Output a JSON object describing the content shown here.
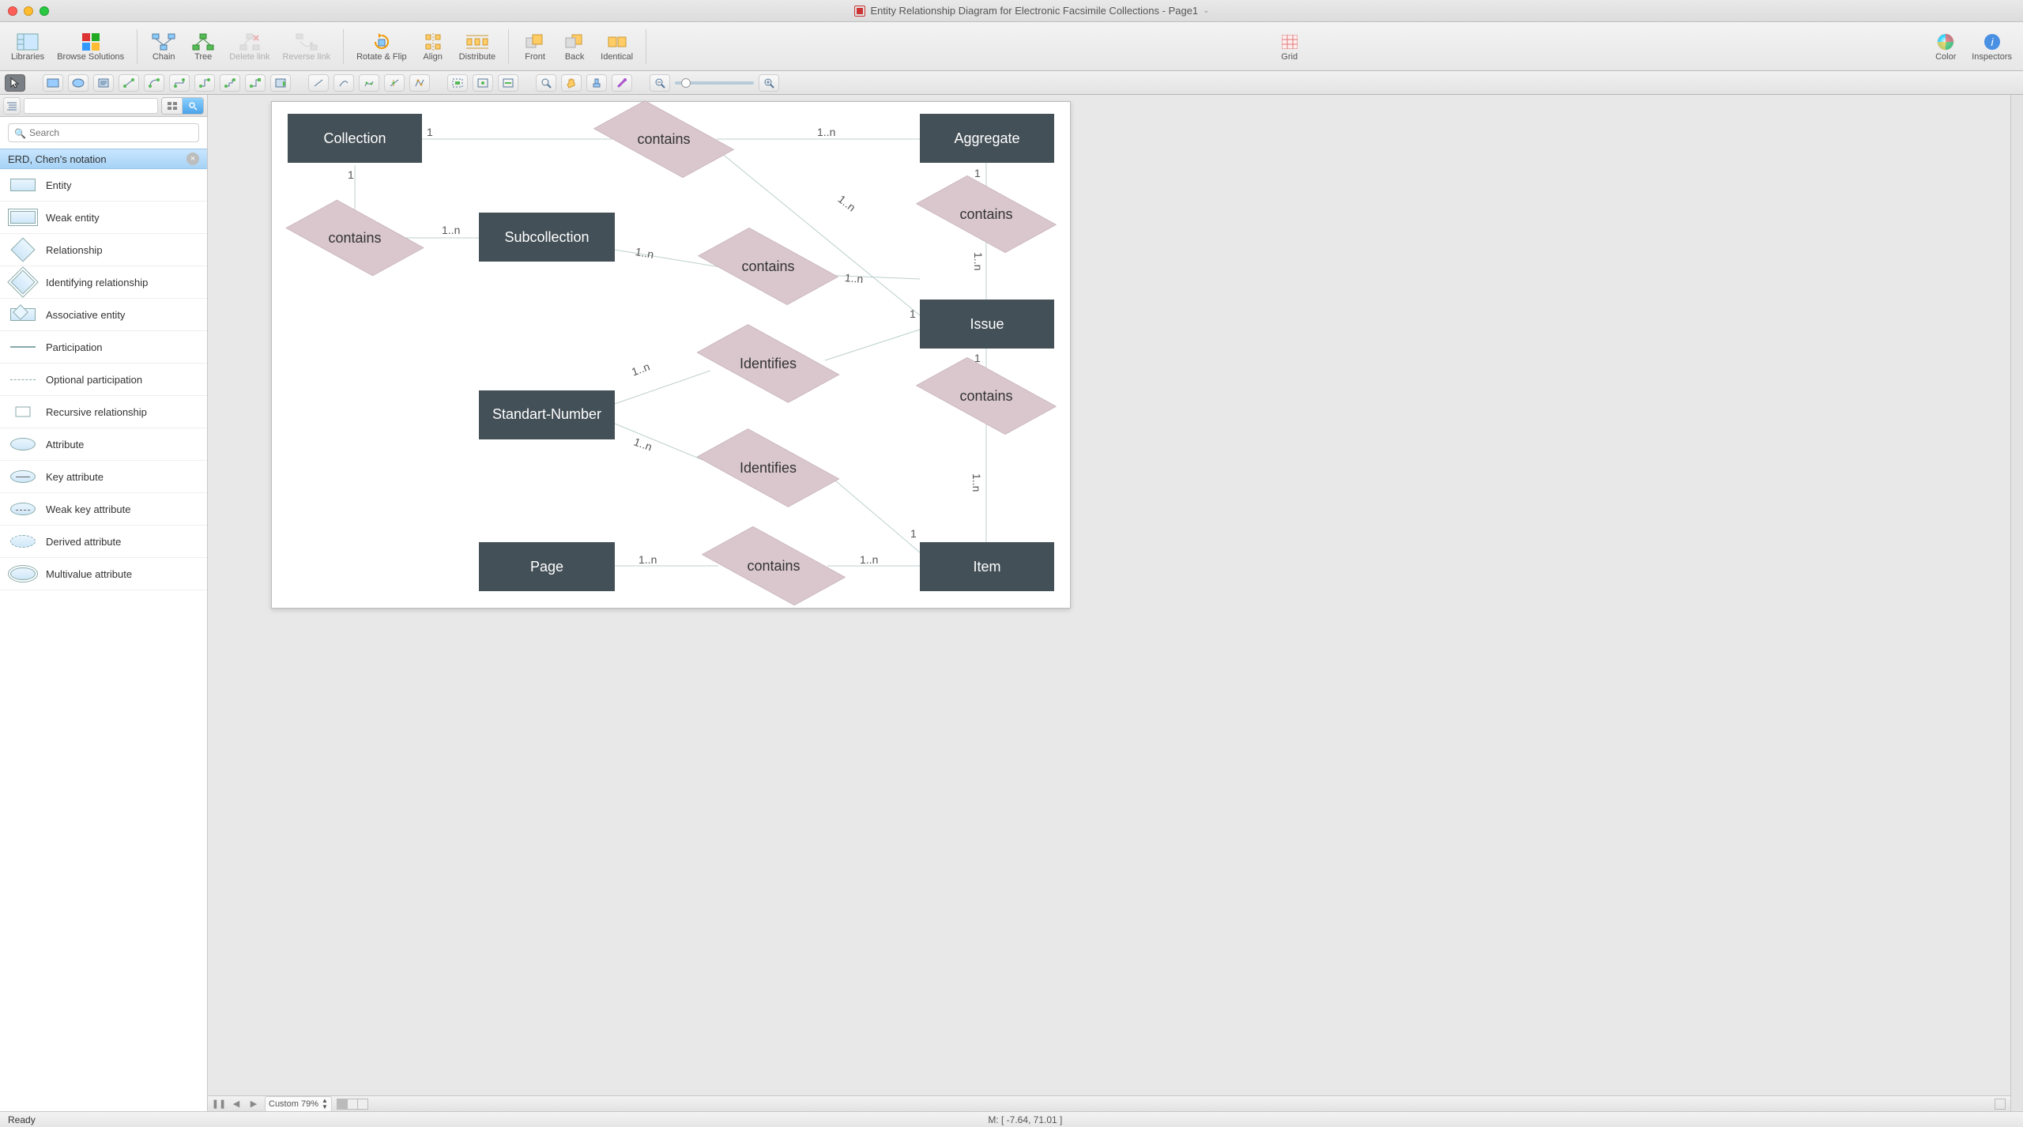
{
  "title": "Entity Relationship Diagram for Electronic Facsimile Collections - Page1",
  "toolbar": {
    "libraries": "Libraries",
    "browse": "Browse Solutions",
    "chain": "Chain",
    "tree": "Tree",
    "delete_link": "Delete link",
    "reverse_link": "Reverse link",
    "rotate": "Rotate & Flip",
    "align": "Align",
    "distribute": "Distribute",
    "front": "Front",
    "back": "Back",
    "identical": "Identical",
    "grid": "Grid",
    "color": "Color",
    "inspectors": "Inspectors"
  },
  "search": {
    "placeholder": "Search"
  },
  "library": {
    "title": "ERD, Chen's notation",
    "items": [
      "Entity",
      "Weak entity",
      "Relationship",
      "Identifying relationship",
      "Associative entity",
      "Participation",
      "Optional participation",
      "Recursive relationship",
      "Attribute",
      "Key attribute",
      "Weak key attribute",
      "Derived attribute",
      "Multivalue attribute"
    ]
  },
  "erd": {
    "entities": {
      "collection": "Collection",
      "aggregate": "Aggregate",
      "subcollection": "Subcollection",
      "issue": "Issue",
      "standart": "Standart-Number",
      "page": "Page",
      "item": "Item"
    },
    "relationships": {
      "contains": "contains",
      "identifies": "Identifies"
    },
    "card": {
      "one": "1",
      "many": "1..n"
    }
  },
  "bottom": {
    "zoom": "Custom 79%"
  },
  "status": {
    "ready": "Ready",
    "mouse": "M: [ -7.64, 71.01 ]"
  }
}
